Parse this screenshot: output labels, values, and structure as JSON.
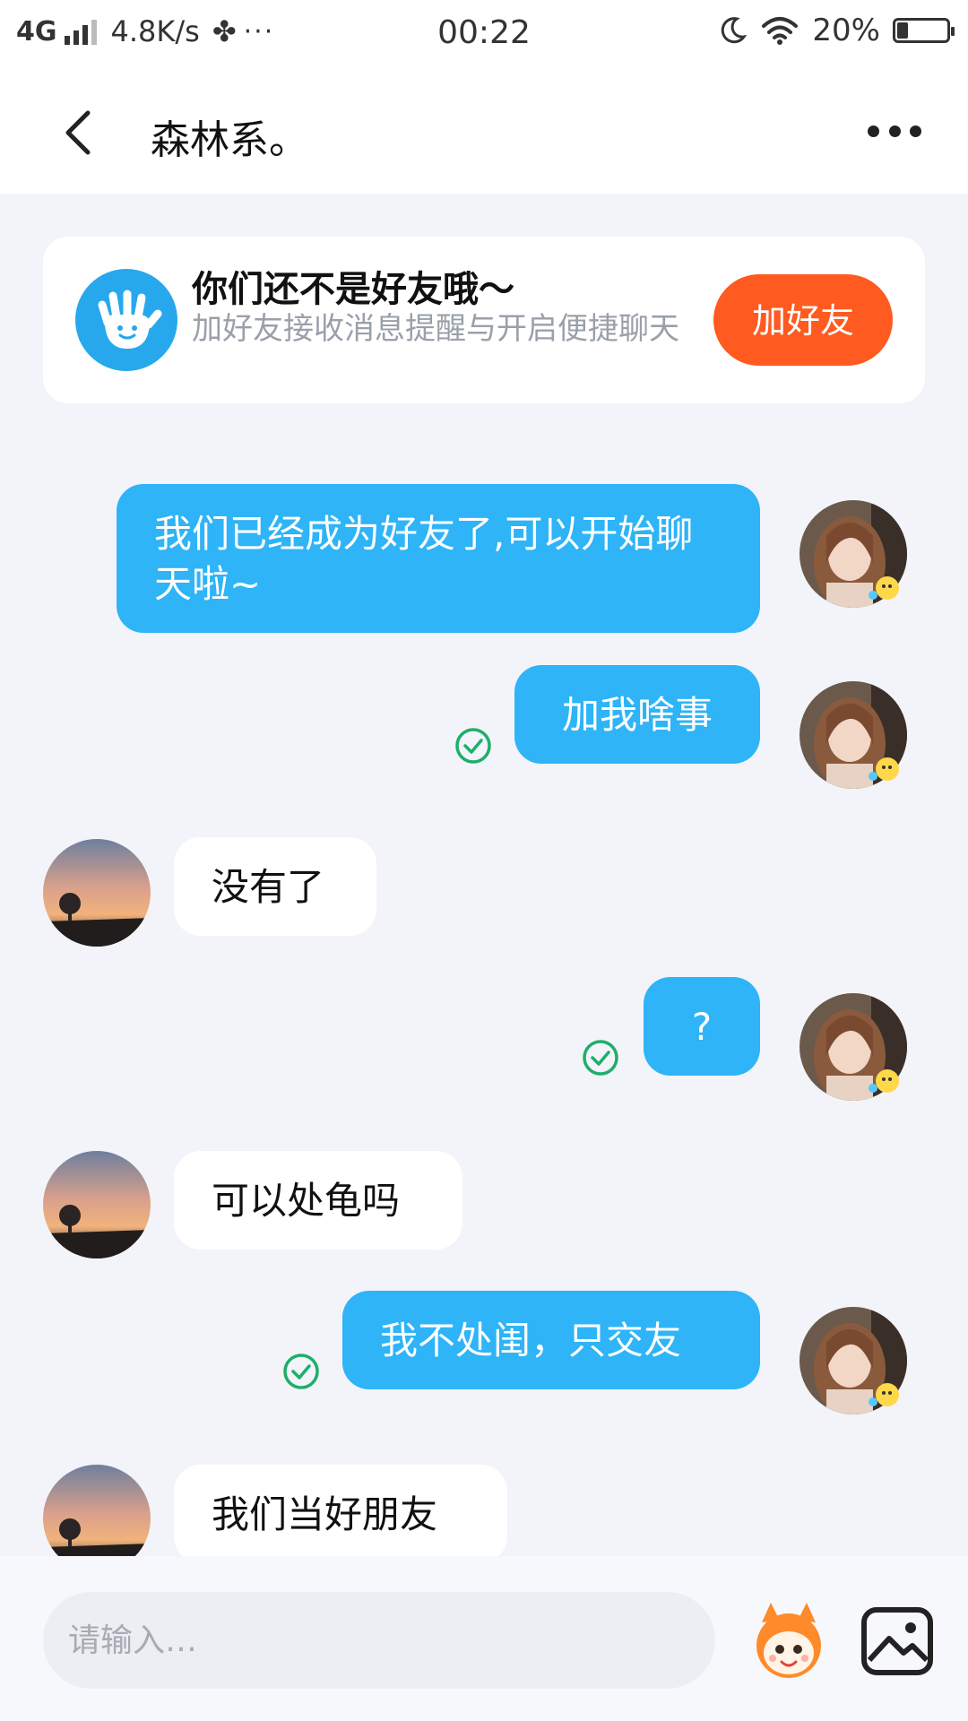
{
  "status_bar": {
    "network": "4G",
    "speed": "4.8K/s",
    "time": "00:22",
    "battery": "20%",
    "battery_level": 0.2
  },
  "header": {
    "title": "森林系。"
  },
  "friend_card": {
    "title": "你们还不是好友哦～",
    "subtitle": "加好友接收消息提醒与开启便捷聊天",
    "button_label": "加好友",
    "button_color": "#ff5a1f"
  },
  "messages": [
    {
      "side": "out",
      "text": "我们已经成为好友了,可以开始聊天啦~",
      "read": false
    },
    {
      "side": "out",
      "text": "加我啥事",
      "read": true
    },
    {
      "side": "in",
      "text": "没有了"
    },
    {
      "side": "out",
      "text": "?",
      "read": true
    },
    {
      "side": "in",
      "text": "可以处龟吗"
    },
    {
      "side": "out",
      "text": "我不处闺，只交友",
      "read": true
    },
    {
      "side": "in",
      "text": "我们当好朋友"
    }
  ],
  "input": {
    "placeholder": "请输入…"
  },
  "colors": {
    "outgoing_bubble": "#2eb4f7",
    "incoming_bubble": "#ffffff",
    "read_check": "#1fae6a",
    "background": "#f2f4f9"
  }
}
